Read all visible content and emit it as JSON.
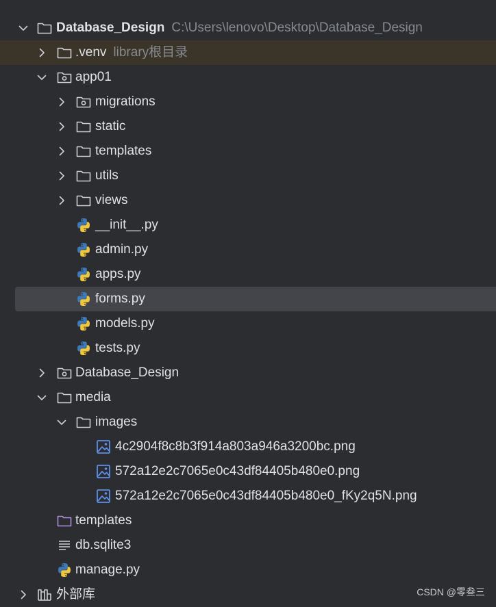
{
  "tree": {
    "root": {
      "label": "Database_Design",
      "path": "C:\\Users\\lenovo\\Desktop\\Database_Design"
    },
    "venv": {
      "label": ".venv",
      "hint": "library根目录"
    },
    "app01": {
      "label": "app01"
    },
    "migrations": {
      "label": "migrations"
    },
    "static": {
      "label": "static"
    },
    "templates_app": {
      "label": "templates"
    },
    "utils": {
      "label": "utils"
    },
    "views": {
      "label": "views"
    },
    "init": {
      "label": "__init__.py"
    },
    "admin": {
      "label": "admin.py"
    },
    "apps": {
      "label": "apps.py"
    },
    "forms": {
      "label": "forms.py"
    },
    "models": {
      "label": "models.py"
    },
    "tests": {
      "label": "tests.py"
    },
    "project_pkg": {
      "label": "Database_Design"
    },
    "media": {
      "label": "media"
    },
    "images": {
      "label": "images"
    },
    "img1": {
      "label": "4c2904f8c8b3f914a803a946a3200bc.png"
    },
    "img2": {
      "label": "572a12e2c7065e0c43df84405b480e0.png"
    },
    "img3": {
      "label": "572a12e2c7065e0c43df84405b480e0_fKy2q5N.png"
    },
    "templates_root": {
      "label": "templates"
    },
    "db": {
      "label": "db.sqlite3"
    },
    "manage": {
      "label": "manage.py"
    },
    "external": {
      "label": "外部库"
    }
  },
  "watermark": "CSDN @零叁三",
  "icons": {
    "folder": "folder-icon",
    "package": "package-folder-icon",
    "python": "python-file-icon",
    "image": "image-file-icon",
    "text": "text-file-icon",
    "library": "library-icon",
    "chevron_right": "chevron-right-icon",
    "chevron_down": "chevron-down-icon"
  },
  "colors": {
    "background": "#2b2d30",
    "selected_row": "#43454a",
    "venv_row": "#3b3428",
    "templates_folder": "#b18ee0",
    "image_icon": "#5e8fe8",
    "python_blue": "#3d79b8",
    "python_yellow": "#f0c83c"
  }
}
